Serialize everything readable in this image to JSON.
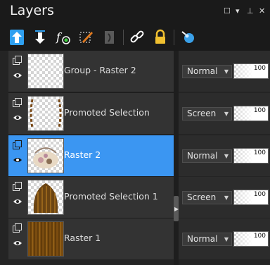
{
  "panel": {
    "title": "Layers"
  },
  "window_controls": {
    "minimize": "☐",
    "dropdown": "▾",
    "pin": "⊥",
    "close": "✕"
  },
  "toolbar": {
    "icons": [
      "move-layer-up-icon",
      "move-layer-down-icon",
      "layer-effects-icon",
      "edit-selection-icon",
      "mask-icon",
      "link-layers-icon",
      "lock-icon",
      "layer-visibility-toggle-icon"
    ]
  },
  "layers": [
    {
      "name": "Group - Raster 2",
      "blend": "Normal",
      "opacity": "100",
      "selected": false,
      "thumb": "transparent"
    },
    {
      "name": "Promoted Selection",
      "blend": "Screen",
      "opacity": "100",
      "selected": false,
      "thumb": "border"
    },
    {
      "name": "Raster 2",
      "blend": "Normal",
      "opacity": "100",
      "selected": true,
      "thumb": "art"
    },
    {
      "name": "Promoted Selection 1",
      "blend": "Screen",
      "opacity": "100",
      "selected": false,
      "thumb": "hair"
    },
    {
      "name": "Raster 1",
      "blend": "Normal",
      "opacity": "100",
      "selected": false,
      "thumb": "wood"
    }
  ],
  "colors": {
    "selected_row": "#3b96f2",
    "row": "#333333",
    "panel": "#242424",
    "titlebar": "#1a1a1a"
  }
}
